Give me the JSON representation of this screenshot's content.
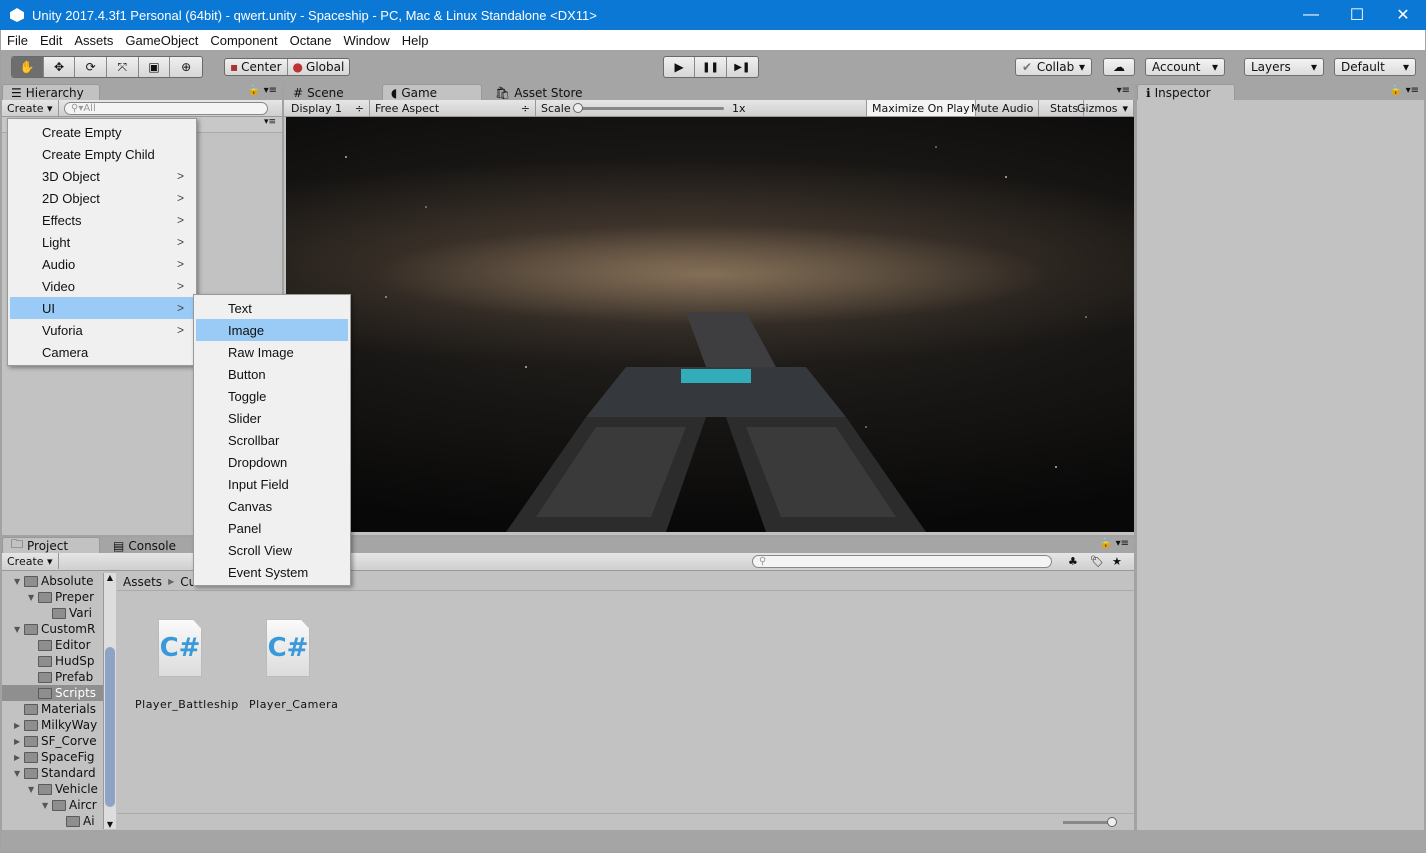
{
  "window": {
    "title": "Unity 2017.4.3f1 Personal (64bit) - qwert.unity - Spaceship - PC, Mac & Linux Standalone <DX11>",
    "minimize": "—",
    "maximize": "☐",
    "close": "✕"
  },
  "menubar": [
    "File",
    "Edit",
    "Assets",
    "GameObject",
    "Component",
    "Octane",
    "Window",
    "Help"
  ],
  "toolbar": {
    "tools": [
      "hand-tool",
      "move-tool",
      "rotate-tool",
      "scale-tool",
      "rect-tool",
      "transform-tool"
    ],
    "active_tool": "hand-tool",
    "pivot": "Center",
    "space": "Global",
    "play": "▶",
    "pause": "❚❚",
    "step": "▶❚",
    "collab": "Collab",
    "account": "Account",
    "layers": "Layers",
    "layout": "Default"
  },
  "hierarchy": {
    "tab": "Hierarchy",
    "create": "Create",
    "search_placeholder": "All"
  },
  "create_menu": {
    "items": [
      {
        "label": "Create Empty",
        "sub": false
      },
      {
        "label": "Create Empty Child",
        "sub": false
      },
      {
        "label": "3D Object",
        "sub": true
      },
      {
        "label": "2D Object",
        "sub": true
      },
      {
        "label": "Effects",
        "sub": true
      },
      {
        "label": "Light",
        "sub": true
      },
      {
        "label": "Audio",
        "sub": true
      },
      {
        "label": "Video",
        "sub": true
      },
      {
        "label": "UI",
        "sub": true
      },
      {
        "label": "Vuforia",
        "sub": true
      },
      {
        "label": "Camera",
        "sub": false
      }
    ],
    "highlighted": "UI"
  },
  "ui_submenu": {
    "items": [
      "Text",
      "Image",
      "Raw Image",
      "Button",
      "Toggle",
      "Slider",
      "Scrollbar",
      "Dropdown",
      "Input Field",
      "Canvas",
      "Panel",
      "Scroll View",
      "Event System"
    ],
    "highlighted": "Image"
  },
  "game": {
    "tabs": [
      "Scene",
      "Game",
      "Asset Store"
    ],
    "active_tab": "Game",
    "display": "Display 1",
    "aspect": "Free Aspect",
    "scale_label": "Scale",
    "scale_value": "1x",
    "maximize": "Maximize On Play",
    "mute": "Mute Audio",
    "stats": "Stats",
    "gizmos": "Gizmos"
  },
  "inspector": {
    "tab": "Inspector"
  },
  "project": {
    "tabs": [
      "Project",
      "Console"
    ],
    "active_tab": "Project",
    "create": "Create",
    "breadcrumb": [
      "Assets",
      "Cu"
    ],
    "tree": [
      {
        "label": "Absolute",
        "depth": 1,
        "exp": "▼"
      },
      {
        "label": "Preper",
        "depth": 2,
        "exp": "▼"
      },
      {
        "label": "Vari",
        "depth": 3,
        "exp": ""
      },
      {
        "label": "CustomR",
        "depth": 1,
        "exp": "▼"
      },
      {
        "label": "Editor",
        "depth": 2,
        "exp": ""
      },
      {
        "label": "HudSp",
        "depth": 2,
        "exp": ""
      },
      {
        "label": "Prefab",
        "depth": 2,
        "exp": ""
      },
      {
        "label": "Scripts",
        "depth": 2,
        "exp": "",
        "selected": true
      },
      {
        "label": "Materials",
        "depth": 1,
        "exp": ""
      },
      {
        "label": "MilkyWay",
        "depth": 1,
        "exp": "▶"
      },
      {
        "label": "SF_Corve",
        "depth": 1,
        "exp": "▶"
      },
      {
        "label": "SpaceFig",
        "depth": 1,
        "exp": "▶"
      },
      {
        "label": "Standard",
        "depth": 1,
        "exp": "▼"
      },
      {
        "label": "Vehicle",
        "depth": 2,
        "exp": "▼"
      },
      {
        "label": "Aircr",
        "depth": 3,
        "exp": "▼"
      },
      {
        "label": "Ai",
        "depth": 4,
        "exp": ""
      }
    ],
    "assets": [
      {
        "name": "Player_Battleship",
        "icon": "csharp-script-icon",
        "glyph": "C#"
      },
      {
        "name": "Player_Camera",
        "icon": "csharp-script-icon",
        "glyph": "C#"
      }
    ]
  }
}
